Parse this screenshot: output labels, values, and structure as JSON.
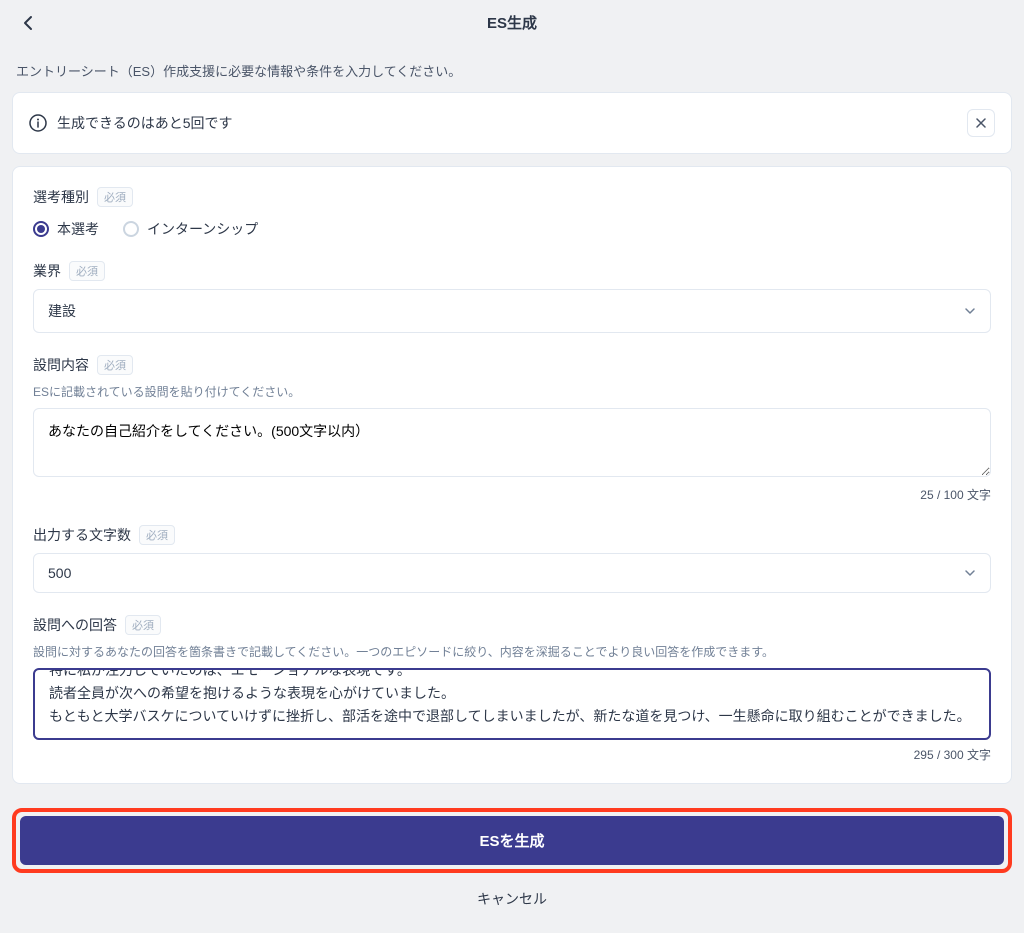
{
  "header": {
    "title": "ES生成"
  },
  "description": "エントリーシート（ES）作成支援に必要な情報や条件を入力してください。",
  "notice": {
    "text": "生成できるのはあと5回です"
  },
  "form": {
    "selection_type": {
      "label": "選考種別",
      "required": "必須",
      "options": [
        {
          "label": "本選考",
          "selected": true
        },
        {
          "label": "インターンシップ",
          "selected": false
        }
      ]
    },
    "industry": {
      "label": "業界",
      "required": "必須",
      "value": "建設"
    },
    "question": {
      "label": "設問内容",
      "required": "必須",
      "help": "ESに記載されている設問を貼り付けてください。",
      "value": "あなたの自己紹介をしてください。(500文字以内）",
      "count": "25 / 100 文字"
    },
    "char_output": {
      "label": "出力する文字数",
      "required": "必須",
      "value": "500"
    },
    "answer": {
      "label": "設問への回答",
      "required": "必須",
      "help": "設問に対するあなたの回答を箇条書きで記載してください。一つのエピソードに絞り、内容を深掘ることでより良い回答を作成できます。",
      "lines": [
        "特に私が注力していたのは、エモーショナルな表現です。",
        "読者全員が次への希望を抱けるような表現を心がけていました。",
        "もともと大学バスケについていけずに挫折し、部活を途中で退部してしまいましたが、新たな道を見つけ、一生懸命に取り組むことができました。"
      ],
      "count": "295 / 300 文字"
    }
  },
  "buttons": {
    "generate": "ESを生成",
    "cancel": "キャンセル"
  }
}
